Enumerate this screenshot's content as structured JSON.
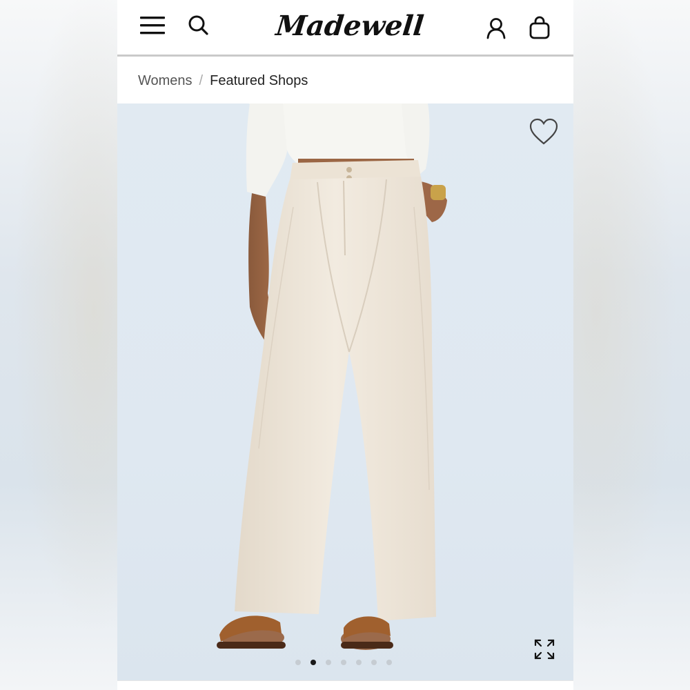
{
  "header": {
    "logo_text": "Madewell",
    "menu_icon": "hamburger-menu-icon",
    "search_icon": "search-icon",
    "account_icon": "user-account-icon",
    "bag_icon": "shopping-bag-icon"
  },
  "breadcrumb": {
    "items": [
      {
        "label": "Womens"
      },
      {
        "label": "Featured Shops"
      }
    ],
    "separator": "/"
  },
  "product_image": {
    "wishlist_icon": "heart-icon",
    "expand_icon": "expand-arrows-icon",
    "carousel": {
      "total": 7,
      "active_index": 1
    }
  },
  "colors": {
    "hero_background": "#dfe8f1",
    "pants": "#efe7db",
    "sweater": "#f7f7f4",
    "active_dot": "#1a1a1a"
  }
}
